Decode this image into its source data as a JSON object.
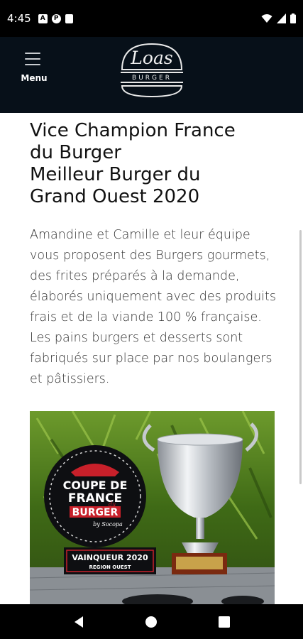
{
  "status_bar": {
    "time": "4:45",
    "left_icons": [
      "a-icon",
      "p-icon",
      "sd-card-icon"
    ],
    "right_icons": [
      "wifi-icon",
      "signal-icon",
      "battery-icon"
    ]
  },
  "header": {
    "menu_label": "Menu",
    "logo_text_top": "Loas",
    "logo_text_bottom": "BURGER",
    "background": "#071019"
  },
  "main": {
    "title_lines": [
      "Vice Champion France",
      "du Burger",
      "Meilleur Burger du",
      "Grand Ouest 2020"
    ],
    "intro": "Amandine et Camille et leur équipe vous proposent des Burgers gourmets, des frites préparés à la demande, élaborés uniquement avec des produits frais et de la viande 100 % française. Les pains burgers et desserts sont fabriqués sur place par nos boulangers et pâtissiers."
  },
  "photo": {
    "trophy_line1": "COUPE DE",
    "trophy_line2": "FRANCE",
    "trophy_du": "du",
    "trophy_line3": "BURGER",
    "trophy_by": "by Socopa",
    "plaque_line1": "VAINQUEUR 2020",
    "plaque_line2": "REGION OUEST"
  },
  "nav_bar": {
    "buttons": [
      "back-icon",
      "home-icon",
      "recents-icon"
    ]
  }
}
